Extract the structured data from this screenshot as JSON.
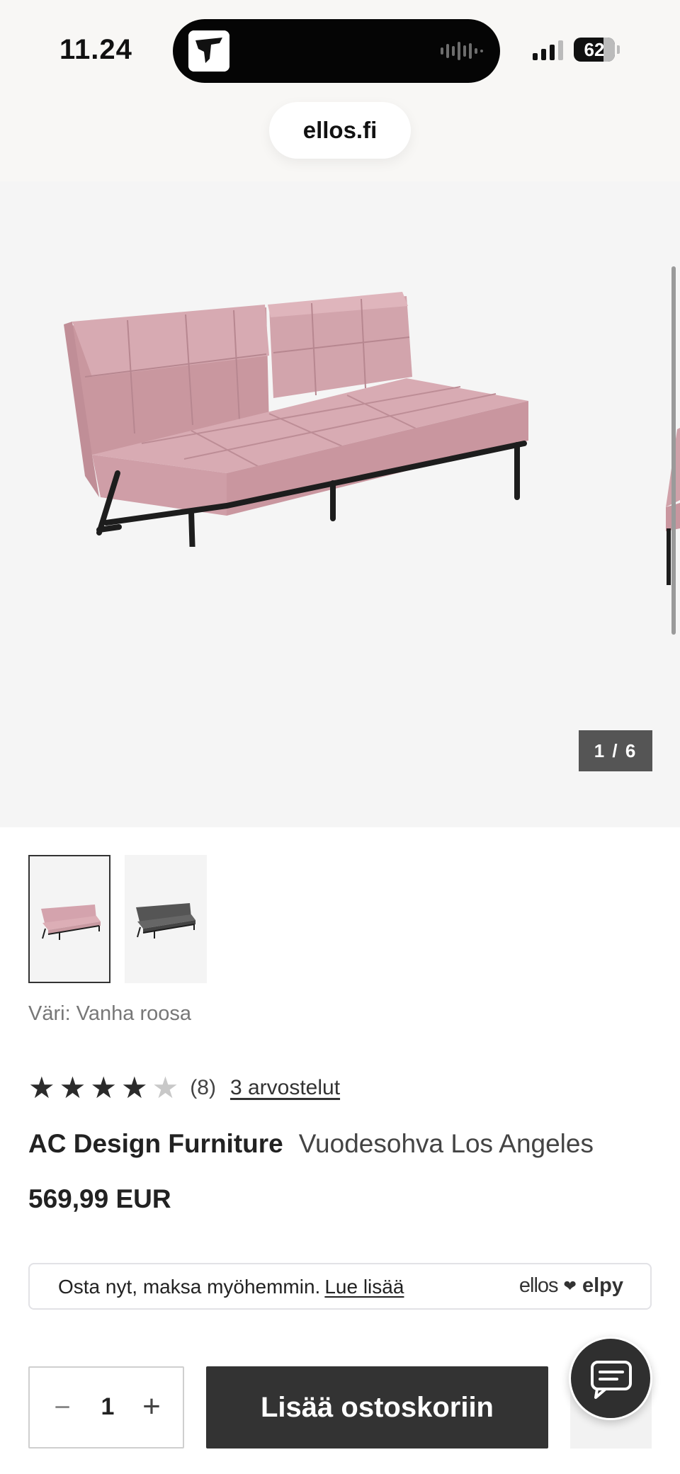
{
  "status_bar": {
    "time": "11.24",
    "battery": "62"
  },
  "browser": {
    "url": "ellos.fi"
  },
  "gallery": {
    "counter": "1 / 6",
    "current_image": 1,
    "total_images": 6
  },
  "thumbnails": [
    {
      "name": "thumbnail-pink-sofa",
      "color": "#d4a3ad"
    },
    {
      "name": "thumbnail-grey-sofa",
      "color": "#555555"
    }
  ],
  "product": {
    "color_label": "Väri: Vanha roosa",
    "rating": 4,
    "rating_max": 5,
    "rating_count": "(8)",
    "reviews_link": "3 arvostelut",
    "brand": "AC Design Furniture",
    "name": "Vuodesohva Los Angeles",
    "price": "569,99 EUR"
  },
  "pay_later": {
    "text": "Osta nyt, maksa myöhemmin.",
    "link": "Lue lisää",
    "logo_left": "ellos",
    "logo_right": "elpy"
  },
  "cart": {
    "minus": "−",
    "quantity": "1",
    "plus": "+",
    "add_label": "Lisää ostoskoriin"
  },
  "colors": {
    "sofa": "#d3a6ae",
    "button": "#333333",
    "image_bg": "#f5f5f5"
  }
}
